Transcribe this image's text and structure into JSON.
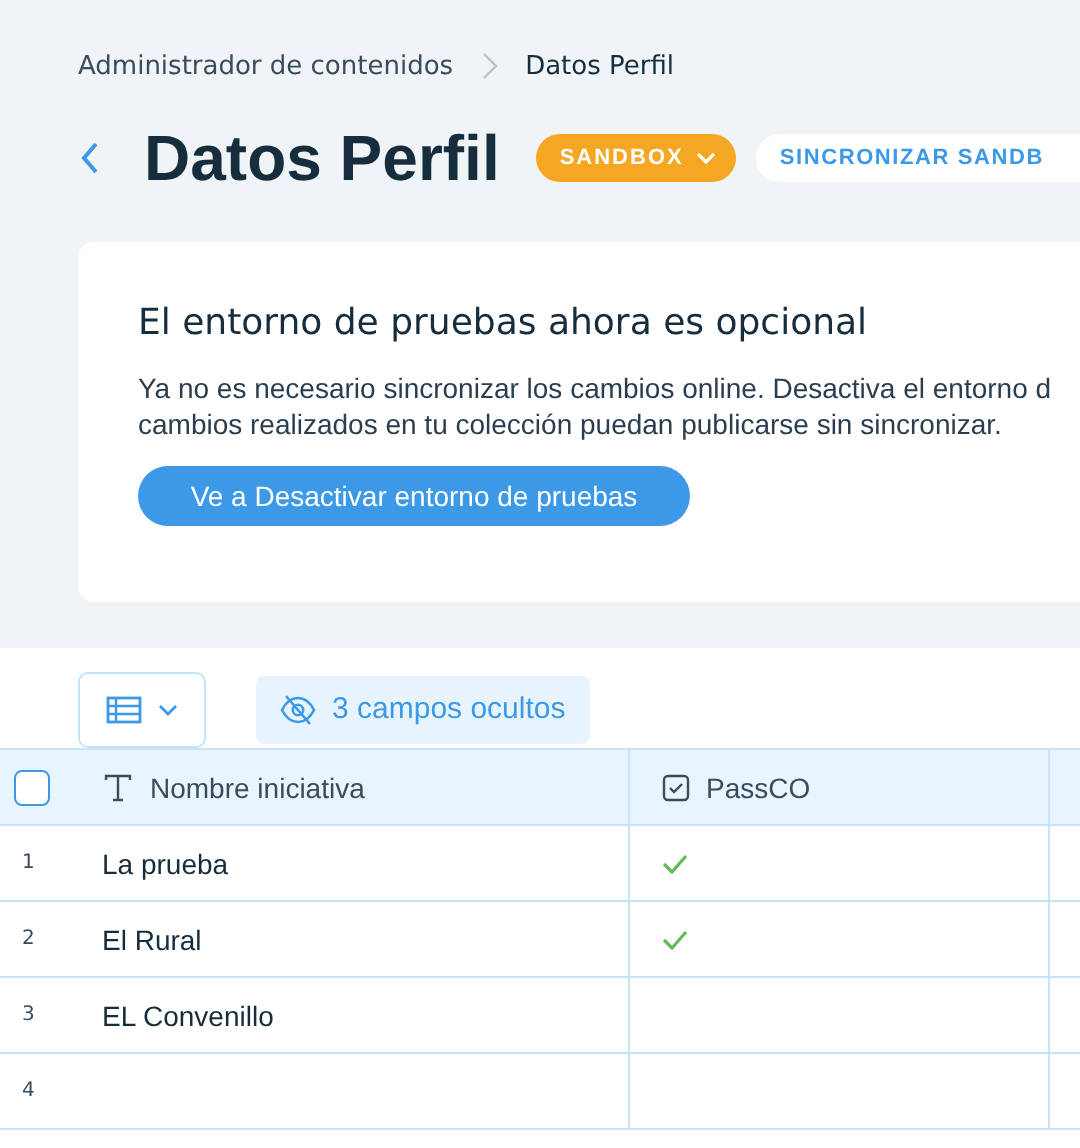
{
  "breadcrumb": {
    "items": [
      "Administrador de contenidos",
      "Datos Perfil"
    ]
  },
  "header": {
    "title": "Datos Perfil",
    "environment_button": "SANDBOX",
    "sync_button": "SINCRONIZAR SANDB"
  },
  "notice": {
    "title": "El entorno de pruebas ahora es opcional",
    "lines": [
      "Ya no es necesario sincronizar los cambios online. Desactiva el entorno d",
      "cambios realizados en tu colección puedan publicarse sin sincronizar."
    ],
    "button": "Ve a Desactivar entorno de pruebas"
  },
  "toolbar": {
    "hidden_fields": "3 campos ocultos"
  },
  "table": {
    "select_all_checked": false,
    "columns": [
      {
        "label": "Nombre iniciativa",
        "kind": "text"
      },
      {
        "label": "PassCO",
        "kind": "boolean"
      }
    ],
    "rows": [
      {
        "number": "1",
        "name": "La prueba",
        "passco": true
      },
      {
        "number": "2",
        "name": "El Rural",
        "passco": true
      },
      {
        "number": "3",
        "name": "EL Convenillo",
        "passco": false
      },
      {
        "number": "4",
        "passco": false
      }
    ]
  }
}
